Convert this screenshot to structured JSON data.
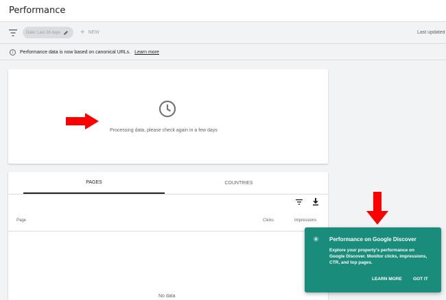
{
  "header": {
    "title": "Performance"
  },
  "filters": {
    "date_chip": "Date: Last 28 days",
    "new_label": "NEW",
    "last_updated": "Last updated"
  },
  "notice": {
    "text": "Performance data is now based on canonical URLs.",
    "link": "Learn more"
  },
  "chart_card": {
    "processing_text": "Processing data, please check again in a few days"
  },
  "table": {
    "tabs": [
      {
        "label": "PAGES",
        "active": true
      },
      {
        "label": "COUNTRIES",
        "active": false
      }
    ],
    "columns": [
      "Page",
      "Clicks",
      "Impressions"
    ],
    "empty_text": "No data"
  },
  "discover_popup": {
    "title": "Performance on Google Discover",
    "body": "Explore your property's performance on Google Discover. Monitor clicks, impressions, CTR, and top pages.",
    "learn_more": "LEARN MORE",
    "got_it": "GOT IT"
  },
  "colors": {
    "accent_teal": "#1a8c7b",
    "arrow_red": "#ff0000"
  },
  "icons": [
    "filter-icon",
    "pencil-icon",
    "plus-icon",
    "info-icon",
    "clock-icon",
    "download-icon",
    "sparkle-icon"
  ]
}
